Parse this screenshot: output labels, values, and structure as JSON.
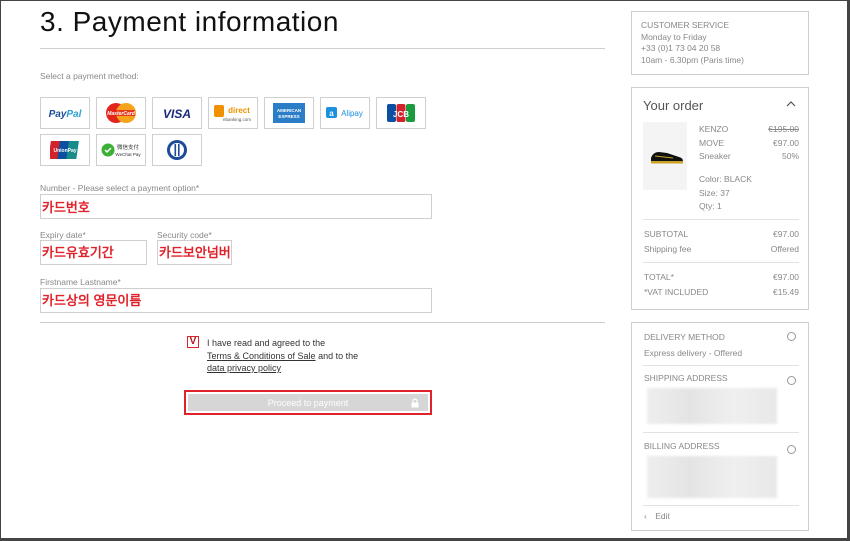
{
  "page": {
    "title": "3. Payment information",
    "select_method_label": "Select a payment method:"
  },
  "payment_methods": [
    {
      "name": "PayPal",
      "icon": "paypal-icon"
    },
    {
      "name": "MasterCard",
      "icon": "mastercard-icon"
    },
    {
      "name": "VISA",
      "icon": "visa-icon"
    },
    {
      "name": "direct ebanking.com",
      "icon": "sofort-icon"
    },
    {
      "name": "AMERICAN EXPRESS",
      "icon": "amex-icon"
    },
    {
      "name": "Alipay",
      "icon": "alipay-icon"
    },
    {
      "name": "JCB",
      "icon": "jcb-icon"
    },
    {
      "name": "UnionPay 银联",
      "icon": "unionpay-icon"
    },
    {
      "name": "微信支付 WeChat Pay",
      "icon": "wechatpay-icon"
    },
    {
      "name": "Diners Club",
      "icon": "diners-icon"
    }
  ],
  "form": {
    "number_label": "Number - Please select a payment option*",
    "number_value": "카드번호",
    "expiry_label": "Expiry date*",
    "expiry_value": "카드유효기간",
    "security_label": "Security code*",
    "security_value": "카드보안넘버",
    "name_label": "Firstname Lastname*",
    "name_value": "카드상의 영문이름"
  },
  "terms": {
    "check_mark": "V",
    "line1": "I have read and agreed to the",
    "link1": "Terms & Conditions of Sale",
    "and_to": " and to the",
    "link2": "data privacy policy"
  },
  "proceed_button": "Proceed to payment",
  "customer_service": {
    "title": "CUSTOMER SERVICE",
    "days": "Monday to Friday",
    "phone": "+33 (0)1 73 04 20 58",
    "hours": "10am - 6.30pm (Paris time)"
  },
  "order": {
    "title": "Your order",
    "product": {
      "brand": "KENZO",
      "name": "MOVE",
      "type": "Sneaker",
      "original_price": "€195.00",
      "price": "€97.00",
      "discount": "50%",
      "color": "Color: BLACK",
      "size": "Size: 37",
      "qty": "Qty: 1"
    },
    "subtotal_label": "SUBTOTAL",
    "subtotal_value": "€97.00",
    "shipping_label": "Shipping fee",
    "shipping_value": "Offered",
    "total_label": "TOTAL*",
    "total_value": "€97.00",
    "vat_label": "*VAT INCLUDED",
    "vat_value": "€15.49"
  },
  "delivery": {
    "method_title": "DELIVERY METHOD",
    "method_value": "Express delivery - Offered",
    "shipping_title": "SHIPPING ADDRESS",
    "billing_title": "BILLING ADDRESS",
    "edit_label": "Edit"
  },
  "colors": {
    "annotation_red": "#e0222a",
    "border": "#cfcfcf",
    "muted_text": "#888888"
  }
}
